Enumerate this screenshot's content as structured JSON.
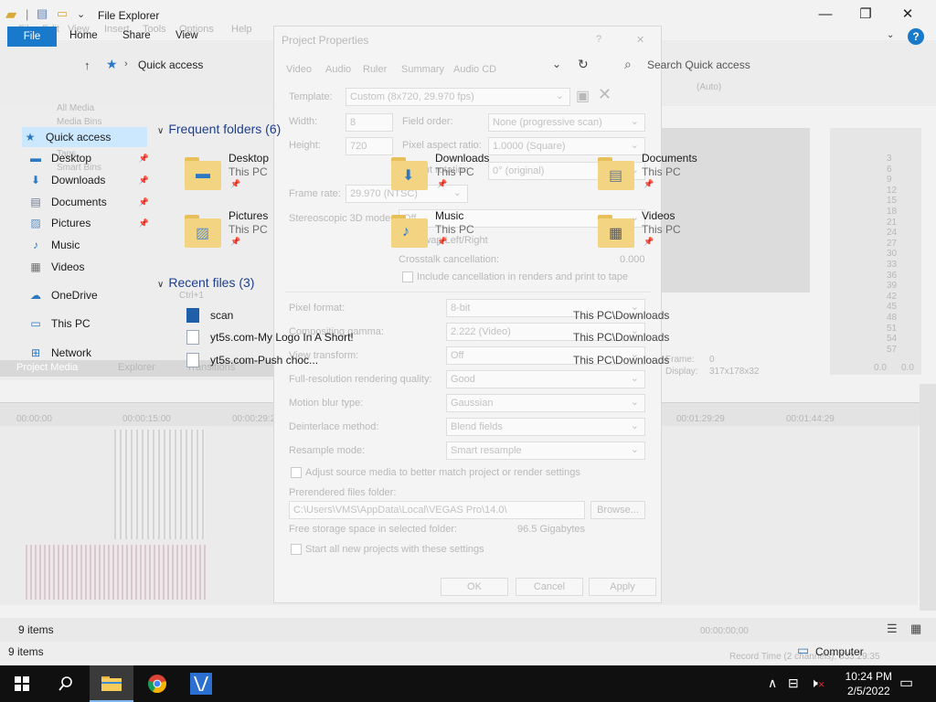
{
  "window": {
    "title": "File Explorer",
    "controls": {
      "minimize": "—",
      "maximize": "❐",
      "close": "✕"
    },
    "help": "?"
  },
  "ribbon": {
    "tabs": [
      "File",
      "Home",
      "Share",
      "View"
    ]
  },
  "address": {
    "path": "Quick access",
    "search_placeholder": "Search Quick access"
  },
  "nav": {
    "items": [
      {
        "label": "Quick access",
        "icon": "star-icon",
        "pinned": false,
        "selected": true
      },
      {
        "label": "Desktop",
        "icon": "desktop-icon",
        "pinned": true
      },
      {
        "label": "Downloads",
        "icon": "download-icon",
        "pinned": true
      },
      {
        "label": "Documents",
        "icon": "document-icon",
        "pinned": true
      },
      {
        "label": "Pictures",
        "icon": "picture-icon",
        "pinned": true
      },
      {
        "label": "Music",
        "icon": "music-icon",
        "pinned": false
      },
      {
        "label": "Videos",
        "icon": "video-icon",
        "pinned": false
      },
      {
        "label": "OneDrive",
        "icon": "cloud-icon",
        "pinned": false
      },
      {
        "label": "This PC",
        "icon": "pc-icon",
        "pinned": false
      },
      {
        "label": "Network",
        "icon": "network-icon",
        "pinned": false
      }
    ]
  },
  "frequent": {
    "header": "Frequent folders (6)",
    "folders": [
      {
        "name": "Desktop",
        "location": "This PC",
        "icon": "desktop-folder-icon"
      },
      {
        "name": "Downloads",
        "location": "This PC",
        "icon": "downloads-folder-icon"
      },
      {
        "name": "Documents",
        "location": "This PC",
        "icon": "documents-folder-icon"
      },
      {
        "name": "Pictures",
        "location": "This PC",
        "icon": "pictures-folder-icon"
      },
      {
        "name": "Music",
        "location": "This PC",
        "icon": "music-folder-icon"
      },
      {
        "name": "Videos",
        "location": "This PC",
        "icon": "videos-folder-icon"
      }
    ]
  },
  "recent": {
    "header": "Recent files (3)",
    "files": [
      {
        "name": "scan",
        "path": "This PC\\Downloads"
      },
      {
        "name": "yt5s.com-My Logo In A Short!",
        "path": "This PC\\Downloads"
      },
      {
        "name": "yt5s.com-Push choc...",
        "path": "This PC\\Downloads"
      }
    ]
  },
  "status": {
    "items_count": "9 items",
    "items_count_inner": "9 items",
    "computer": "Computer"
  },
  "background_app": {
    "menu": [
      "File",
      "Edit",
      "View",
      "Insert",
      "Tools",
      "Options",
      "Help"
    ],
    "media_tree": [
      "All Media",
      "Media Bins",
      "Tags",
      "Smart Bins"
    ],
    "tabs": [
      "Project Media",
      "Explorer",
      "Transitions"
    ],
    "ruler_times": [
      "00:00:00",
      "00:00:15:00",
      "00:00:29:29",
      "00:01:29:29",
      "00:01:44:29"
    ],
    "preview_auto": "(Auto)",
    "frame_label": "Frame:",
    "frame_value": "0",
    "display_label": "Display:",
    "display_value": "317x178x32",
    "ctrl_hint": "Ctrl+1",
    "meter_labels": [
      "3",
      "6",
      "9",
      "12",
      "15",
      "18",
      "21",
      "24",
      "27",
      "30",
      "33",
      "36",
      "39",
      "42",
      "45",
      "48",
      "51",
      "54",
      "57"
    ],
    "meter_bottom": [
      "0.0",
      "0.0"
    ],
    "timecode": "00:00:00;00",
    "record_time": "Record Time (2 channels): 333:29:35"
  },
  "dialog": {
    "title": "Project Properties",
    "tabs": [
      "Video",
      "Audio",
      "Ruler",
      "Summary",
      "Audio CD"
    ],
    "template_label": "Template:",
    "template_value": "Custom (8x720, 29.970 fps)",
    "width_label": "Width:",
    "width_value": "8",
    "height_label": "Height:",
    "height_value": "720",
    "field_order_label": "Field order:",
    "field_order_value": "None (progressive scan)",
    "pixel_aspect_label": "Pixel aspect ratio:",
    "pixel_aspect_value": "1.0000 (Square)",
    "output_rotation_label": "Output rotation:",
    "output_rotation_value": "0° (original)",
    "frame_rate_label": "Frame rate:",
    "frame_rate_value": "29.970 (NTSC)",
    "stereo_label": "Stereoscopic 3D mode:",
    "stereo_value": "Off",
    "swap_label": "Swap Left/Right",
    "crosstalk_label": "Crosstalk cancellation:",
    "crosstalk_value": "0.000",
    "include_label": "Include cancellation in renders and print to tape",
    "pixel_format_label": "Pixel format:",
    "pixel_format_value": "8-bit",
    "compositing_label": "Compositing gamma:",
    "compositing_value": "2.222 (Video)",
    "view_transform_label": "View transform:",
    "view_transform_value": "Off",
    "full_res_label": "Full-resolution rendering quality:",
    "full_res_value": "Good",
    "motion_blur_label": "Motion blur type:",
    "motion_blur_value": "Gaussian",
    "deinterlace_label": "Deinterlace method:",
    "deinterlace_value": "Blend fields",
    "resample_label": "Resample mode:",
    "resample_value": "Smart resample",
    "adjust_label": "Adjust source media to better match project or render settings",
    "prerendered_label": "Prerendered files folder:",
    "prerendered_value": "C:\\Users\\VMS\\AppData\\Local\\VEGAS Pro\\14.0\\",
    "browse_label": "Browse...",
    "free_storage_label": "Free storage space in selected folder:",
    "free_storage_value": "96.5 Gigabytes",
    "start_all_label": "Start all new projects with these settings",
    "ok": "OK",
    "cancel": "Cancel",
    "apply": "Apply",
    "help": "?",
    "close": "✕"
  },
  "taskbar": {
    "time": "10:24 PM",
    "date": "2/5/2022"
  },
  "colors": {
    "accent": "#1979ca",
    "selection": "#cce8ff",
    "section_header": "#1e3f8c",
    "taskbar": "#101010"
  }
}
